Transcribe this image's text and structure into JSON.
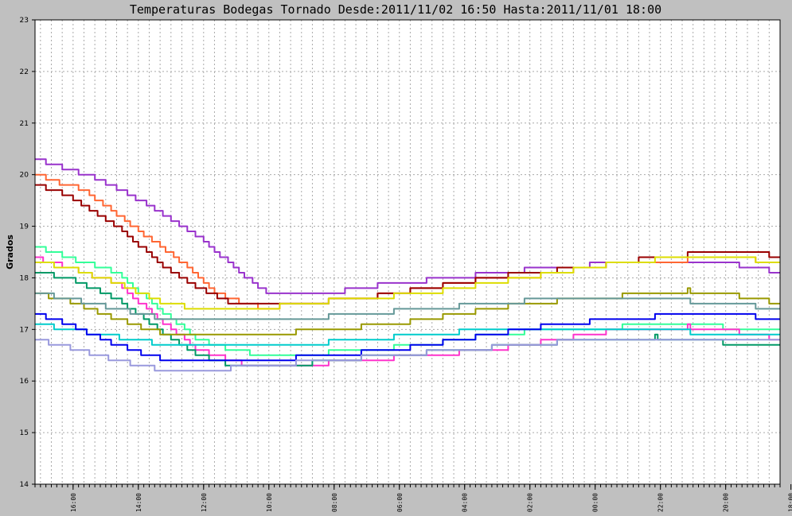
{
  "chart_data": {
    "type": "line",
    "title": "Temperaturas Bodegas Tornado Desde:2011/11/02 16:50 Hasta:2011/11/01 18:00",
    "ylabel": "Grados",
    "xlabel": "",
    "ylim": [
      14,
      23
    ],
    "yticks": [
      "23",
      "22",
      "21",
      "20",
      "19",
      "18",
      "17",
      "16",
      "15",
      "14"
    ],
    "x_tick_labels": [
      "16:00",
      "14:00",
      "12:00",
      "10:00",
      "08:00",
      "06:00",
      "04:00",
      "02:00",
      "00:00",
      "22:00",
      "20:00",
      "18:00"
    ],
    "x_tick_values": [
      70,
      190,
      310,
      430,
      550,
      670,
      790,
      910,
      1030,
      1150,
      1270,
      1390
    ],
    "xlim": [
      0,
      1370
    ],
    "x_reversed": true,
    "x_unit": "minutes before 2011/11/02 16:50",
    "grid": true,
    "background": "#ffffff",
    "frame_background": "#c0c0c0",
    "series": [
      {
        "color": "#9933cc",
        "x": [
          0,
          60,
          120,
          210,
          300,
          390,
          420,
          460,
          540,
          600,
          660,
          720,
          780,
          840,
          900,
          960,
          1020,
          1080,
          1140,
          1200,
          1260,
          1320,
          1370
        ],
        "y": [
          20.3,
          20.1,
          19.9,
          19.4,
          18.8,
          18.0,
          17.75,
          17.7,
          17.7,
          17.8,
          17.9,
          17.95,
          18.0,
          18.1,
          18.15,
          18.2,
          18.25,
          18.3,
          18.3,
          18.3,
          18.3,
          18.2,
          18.1
        ]
      },
      {
        "color": "#ff6633",
        "x": [
          0,
          30,
          90,
          180,
          270,
          330,
          420,
          480,
          540,
          600,
          660,
          720,
          780,
          840,
          900,
          960,
          1020,
          1080,
          1140,
          1200,
          1260,
          1320,
          1370
        ],
        "y": [
          20.0,
          19.9,
          19.7,
          19.0,
          18.3,
          17.7,
          17.4,
          17.5,
          17.55,
          17.6,
          17.7,
          17.8,
          17.9,
          18.0,
          18.0,
          18.1,
          18.2,
          18.3,
          18.3,
          18.35,
          18.35,
          18.35,
          18.3
        ]
      },
      {
        "color": "#990000",
        "x": [
          0,
          60,
          150,
          240,
          300,
          360,
          420,
          480,
          540,
          600,
          660,
          720,
          780,
          840,
          900,
          960,
          1020,
          1080,
          1140,
          1200,
          1260,
          1320,
          1370
        ],
        "y": [
          19.8,
          19.6,
          19.0,
          18.2,
          17.8,
          17.5,
          17.45,
          17.5,
          17.55,
          17.6,
          17.7,
          17.8,
          17.9,
          18.0,
          18.1,
          18.15,
          18.2,
          18.3,
          18.4,
          18.45,
          18.5,
          18.5,
          18.4
        ]
      },
      {
        "color": "#33ff99",
        "x": [
          0,
          60,
          150,
          240,
          300,
          360,
          420,
          480,
          540,
          600,
          660,
          720,
          780,
          840,
          900,
          960,
          1020,
          1080,
          1140,
          1200,
          1260,
          1320,
          1370
        ],
        "y": [
          18.6,
          18.4,
          18.1,
          17.3,
          16.8,
          16.6,
          16.5,
          16.5,
          16.55,
          16.6,
          16.65,
          16.7,
          16.8,
          16.9,
          16.95,
          17.0,
          17.0,
          17.05,
          17.1,
          17.1,
          17.05,
          17.0,
          16.95
        ]
      },
      {
        "color": "#ff33cc",
        "x": [
          0,
          60,
          150,
          240,
          300,
          360,
          420,
          480,
          540,
          600,
          660,
          720,
          780,
          840,
          900,
          960,
          1020,
          1080,
          1140,
          1200,
          1260,
          1320,
          1370
        ],
        "y": [
          18.4,
          18.2,
          17.9,
          17.1,
          16.6,
          16.4,
          16.25,
          16.3,
          16.35,
          16.4,
          16.45,
          16.5,
          16.55,
          16.6,
          16.7,
          16.8,
          16.9,
          17.0,
          17.0,
          17.05,
          17.0,
          16.9,
          16.8
        ]
      },
      {
        "color": "#dddd00",
        "x": [
          0,
          60,
          150,
          240,
          300,
          360,
          420,
          480,
          540,
          600,
          660,
          720,
          780,
          840,
          900,
          960,
          1020,
          1080,
          1140,
          1200,
          1260,
          1320,
          1370
        ],
        "y": [
          18.3,
          18.2,
          17.9,
          17.5,
          17.4,
          17.4,
          17.4,
          17.5,
          17.55,
          17.6,
          17.65,
          17.7,
          17.8,
          17.9,
          18.0,
          18.1,
          18.2,
          18.3,
          18.35,
          18.4,
          18.4,
          18.35,
          18.3
        ]
      },
      {
        "color": "#009966",
        "x": [
          0,
          60,
          150,
          240,
          300,
          360,
          420,
          480,
          540,
          600,
          660,
          720,
          780,
          840,
          900,
          960,
          1020,
          1080,
          1140,
          1200,
          1260,
          1320,
          1370
        ],
        "y": [
          18.1,
          18.0,
          17.6,
          16.9,
          16.5,
          16.3,
          16.3,
          16.3,
          16.4,
          16.45,
          16.5,
          16.55,
          16.6,
          16.65,
          16.7,
          16.75,
          16.8,
          16.8,
          16.85,
          16.8,
          16.75,
          16.7,
          16.7
        ]
      },
      {
        "color": "#999900",
        "x": [
          0,
          60,
          150,
          240,
          300,
          360,
          420,
          480,
          540,
          600,
          660,
          720,
          780,
          840,
          900,
          960,
          1020,
          1080,
          1140,
          1200,
          1260,
          1320,
          1370
        ],
        "y": [
          17.7,
          17.55,
          17.2,
          16.9,
          16.9,
          16.9,
          16.9,
          16.95,
          17.0,
          17.05,
          17.1,
          17.2,
          17.3,
          17.4,
          17.5,
          17.55,
          17.6,
          17.65,
          17.7,
          17.75,
          17.7,
          17.6,
          17.5
        ]
      },
      {
        "color": "#669999",
        "x": [
          0,
          60,
          150,
          240,
          300,
          360,
          420,
          480,
          540,
          600,
          660,
          720,
          780,
          840,
          900,
          960,
          1020,
          1080,
          1140,
          1200,
          1260,
          1320,
          1370
        ],
        "y": [
          17.7,
          17.6,
          17.4,
          17.2,
          17.2,
          17.2,
          17.2,
          17.2,
          17.25,
          17.3,
          17.35,
          17.4,
          17.45,
          17.5,
          17.55,
          17.6,
          17.6,
          17.6,
          17.6,
          17.55,
          17.5,
          17.45,
          17.4
        ]
      },
      {
        "color": "#00cccc",
        "x": [
          0,
          60,
          150,
          240,
          300,
          360,
          420,
          480,
          540,
          600,
          660,
          720,
          780,
          840,
          900,
          960,
          1020,
          1080,
          1140,
          1200,
          1260,
          1320,
          1370
        ],
        "y": [
          17.1,
          17.0,
          16.85,
          16.7,
          16.7,
          16.7,
          16.7,
          16.7,
          16.75,
          16.8,
          16.85,
          16.9,
          16.95,
          17.0,
          17.0,
          17.0,
          17.0,
          17.0,
          17.0,
          16.95,
          16.9,
          16.9,
          16.9
        ]
      },
      {
        "color": "#0000ee",
        "x": [
          0,
          60,
          150,
          240,
          300,
          360,
          420,
          480,
          540,
          600,
          660,
          720,
          780,
          840,
          900,
          960,
          1020,
          1080,
          1140,
          1200,
          1260,
          1320,
          1370
        ],
        "y": [
          17.3,
          17.1,
          16.7,
          16.4,
          16.4,
          16.4,
          16.4,
          16.45,
          16.5,
          16.55,
          16.6,
          16.7,
          16.8,
          16.9,
          17.0,
          17.1,
          17.15,
          17.2,
          17.25,
          17.3,
          17.3,
          17.25,
          17.2
        ]
      },
      {
        "color": "#9999dd",
        "x": [
          0,
          60,
          150,
          240,
          300,
          360,
          420,
          480,
          540,
          600,
          660,
          720,
          780,
          840,
          900,
          960,
          1020,
          1080,
          1140,
          1200,
          1260,
          1320,
          1370
        ],
        "y": [
          16.8,
          16.65,
          16.4,
          16.2,
          16.2,
          16.25,
          16.3,
          16.35,
          16.4,
          16.45,
          16.5,
          16.55,
          16.6,
          16.65,
          16.7,
          16.75,
          16.8,
          16.8,
          16.8,
          16.8,
          16.8,
          16.8,
          16.8
        ]
      }
    ]
  }
}
